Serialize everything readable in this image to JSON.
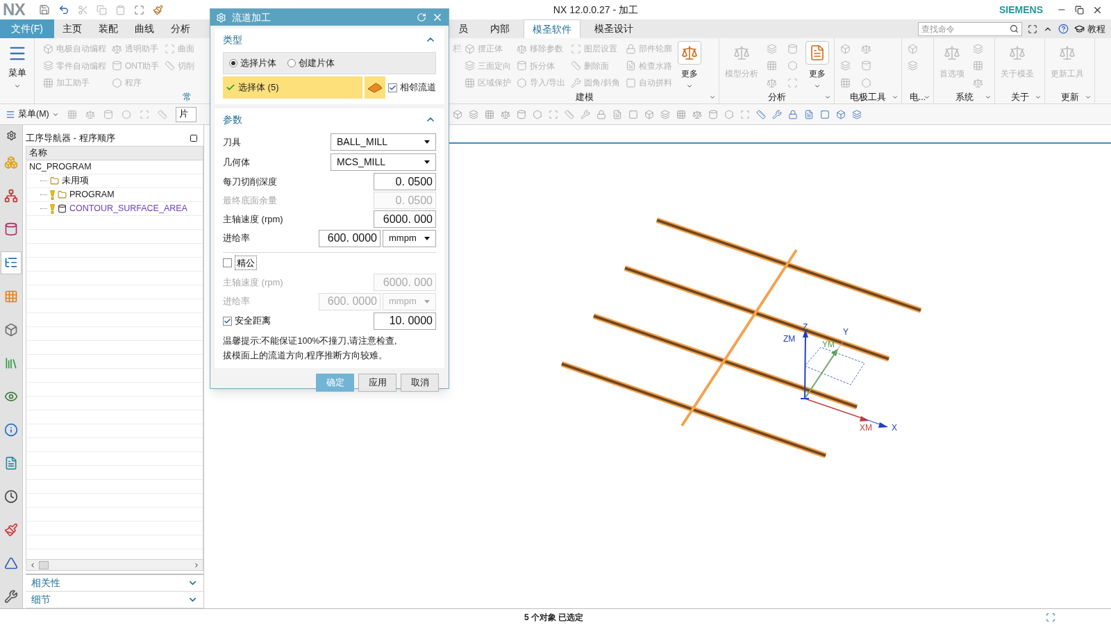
{
  "title_bar": {
    "logo": "NX",
    "title": "NX 12.0.0.27 - 加工",
    "brand": "SIEMENS"
  },
  "tabs_left": [
    {
      "label": "文件(F)",
      "kind": "file",
      "selected": false
    },
    {
      "label": "主页",
      "selected": false
    },
    {
      "label": "装配",
      "selected": false
    },
    {
      "label": "曲线",
      "selected": false
    },
    {
      "label": "分析",
      "selected": false
    }
  ],
  "tabs_right": [
    {
      "label": "员",
      "selected": false
    },
    {
      "label": "内部",
      "selected": false
    },
    {
      "label": "模圣软件",
      "selected": true
    },
    {
      "label": "模圣设计",
      "selected": false
    }
  ],
  "search": {
    "placeholder": "查找命令"
  },
  "help_label": "教程",
  "ribbon_left": {
    "menu_button": "菜单",
    "group_label": "常",
    "tools": [
      {
        "kind": "small",
        "label": "电极自动编程",
        "disabled": true
      },
      {
        "kind": "small",
        "label": "零件自动编程",
        "disabled": true
      },
      {
        "kind": "small",
        "label": "加工助手",
        "disabled": true
      },
      {
        "kind": "small",
        "label": "透明助手",
        "disabled": true
      },
      {
        "kind": "small",
        "label": "ONT助手",
        "disabled": true
      },
      {
        "kind": "small",
        "label": "程序",
        "disabled": true
      },
      {
        "kind": "small",
        "label": "曲面",
        "disabled": true
      },
      {
        "kind": "small",
        "label": "切削",
        "disabled": true
      }
    ]
  },
  "ribbon_groups": [
    {
      "label": "建模",
      "lead": "栏",
      "tools": [
        {
          "kind": "small",
          "label": "摆正体",
          "disabled": true
        },
        {
          "kind": "small",
          "label": "三面定向",
          "disabled": true
        },
        {
          "kind": "small",
          "label": "区域保护",
          "disabled": true
        },
        {
          "kind": "small",
          "label": "移除参数",
          "disabled": true
        },
        {
          "kind": "small",
          "label": "拆分体",
          "disabled": true
        },
        {
          "kind": "small",
          "label": "导入/导出",
          "disabled": true
        },
        {
          "kind": "small",
          "label": "图层设置",
          "disabled": true
        },
        {
          "kind": "small",
          "label": "删除面",
          "disabled": true
        },
        {
          "kind": "small",
          "label": "圆角/斜角",
          "disabled": true
        },
        {
          "kind": "small",
          "label": "部件轮廓",
          "disabled": true
        },
        {
          "kind": "small",
          "label": "检查水路",
          "disabled": true
        },
        {
          "kind": "small",
          "label": "自动拼料",
          "disabled": true
        },
        {
          "kind": "big",
          "label": "更多",
          "disabled": false
        }
      ]
    },
    {
      "label": "分析",
      "tools": [
        {
          "kind": "big",
          "label": "模型分析",
          "disabled": true
        },
        {
          "kind": "icon",
          "disabled": true
        },
        {
          "kind": "icon",
          "disabled": true
        },
        {
          "kind": "icon",
          "disabled": true
        },
        {
          "kind": "icon",
          "disabled": true
        },
        {
          "kind": "icon",
          "disabled": true
        },
        {
          "kind": "icon",
          "disabled": true
        },
        {
          "kind": "big",
          "label": "更多",
          "disabled": false
        }
      ]
    },
    {
      "label": "电极工具",
      "tools": [
        {
          "kind": "icon",
          "disabled": true
        },
        {
          "kind": "icon",
          "disabled": true
        },
        {
          "kind": "icon",
          "disabled": true
        },
        {
          "kind": "icon",
          "disabled": true
        },
        {
          "kind": "icon",
          "disabled": true
        },
        {
          "kind": "icon",
          "disabled": true
        }
      ]
    },
    {
      "label": "电...",
      "tools": [
        {
          "kind": "icon",
          "disabled": true
        },
        {
          "kind": "icon",
          "disabled": true
        }
      ]
    },
    {
      "label": "系统",
      "tools": [
        {
          "kind": "big",
          "label": "首选项",
          "disabled": true
        },
        {
          "kind": "icon",
          "disabled": true
        },
        {
          "kind": "icon",
          "disabled": true
        },
        {
          "kind": "icon",
          "disabled": true
        }
      ]
    },
    {
      "label": "关于",
      "tools": [
        {
          "kind": "big",
          "label": "关于模圣",
          "disabled": true
        }
      ]
    },
    {
      "label": "更新",
      "tools": [
        {
          "kind": "big",
          "label": "更新工具",
          "disabled": true
        }
      ]
    }
  ],
  "toolbar": {
    "menu_button": "菜单(M)",
    "filter_value": "片"
  },
  "navigator": {
    "title": "工序导航器 - 程序顺序",
    "column": "名称",
    "tree": [
      {
        "label": "NC_PROGRAM",
        "children": [
          {
            "label": "未用项",
            "kind": "group",
            "warning": false
          },
          {
            "label": "PROGRAM",
            "kind": "group",
            "warning": true
          },
          {
            "label": "CONTOUR_SURFACE_AREA",
            "kind": "operation",
            "warning": true
          }
        ]
      }
    ],
    "panels": [
      {
        "label": "相关性",
        "expanded": false
      },
      {
        "label": "细节",
        "expanded": false
      }
    ]
  },
  "resource_tabs": [
    {
      "selected": false
    },
    {
      "selected": false
    },
    {
      "selected": false
    },
    {
      "selected": true
    },
    {
      "selected": false
    },
    {
      "selected": false
    },
    {
      "selected": false
    },
    {
      "selected": false
    },
    {
      "selected": false
    },
    {
      "selected": false
    },
    {
      "selected": false
    },
    {
      "selected": false
    },
    {
      "selected": false
    },
    {
      "selected": false
    }
  ],
  "dialog": {
    "title": "流道加工",
    "type_section": {
      "title": "类型",
      "expanded": true,
      "radios": [
        {
          "label": "选择片体",
          "selected": true
        },
        {
          "label": "创建片体",
          "selected": false
        }
      ],
      "selection": {
        "label": "选择体 (5)",
        "complete": true
      },
      "adjacent": {
        "label": "相邻流道",
        "checked": true
      }
    },
    "params_section": {
      "title": "参数",
      "expanded": true
    },
    "rows": [
      {
        "kind": "select",
        "label": "刀具",
        "value": "BALL_MILL",
        "disabled": false
      },
      {
        "kind": "select",
        "label": "几何体",
        "value": "MCS_MILL",
        "disabled": false
      },
      {
        "kind": "number",
        "label": "每刀切削深度",
        "value": "0. 0500",
        "disabled": false
      },
      {
        "kind": "number",
        "label": "最终底面余量",
        "value": "0. 0500",
        "disabled": true
      },
      {
        "kind": "number",
        "label": "主轴速度 (rpm)",
        "value": "6000. 000",
        "disabled": false
      },
      {
        "kind": "number_unit",
        "label": "进给率",
        "value": "600. 0000",
        "unit": "mmpm",
        "disabled": false
      },
      {
        "kind": "checkbox",
        "label": "精公",
        "checked": false
      },
      {
        "kind": "number",
        "label": "主轴速度 (rpm)",
        "value": "6000. 000",
        "disabled": true
      },
      {
        "kind": "number_unit",
        "label": "进给率",
        "value": "600. 0000",
        "unit": "mmpm",
        "disabled": true
      },
      {
        "kind": "checkbox_number",
        "label": "安全距离",
        "checked": true,
        "value": "10. 0000"
      }
    ],
    "hint": [
      "温馨提示:不能保证100%不撞刀,请注意检查,",
      "拔模面上的流道方向,程序推断方向较难。"
    ],
    "buttons": [
      {
        "label": "确定",
        "kind": "primary"
      },
      {
        "label": "应用",
        "kind": "normal"
      },
      {
        "label": "取消",
        "kind": "normal"
      }
    ]
  },
  "triad_labels": [
    "Z",
    "ZM",
    "Y",
    "YM",
    "XM",
    "X"
  ],
  "status": "5 个对象 已选定"
}
